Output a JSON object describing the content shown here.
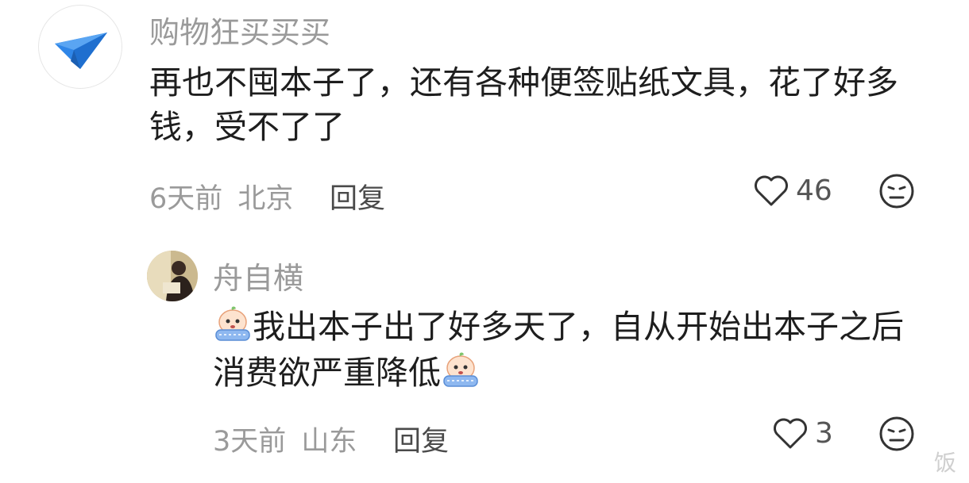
{
  "comments": [
    {
      "username": "购物狂买买买",
      "text": "再也不囤本子了，还有各种便签贴纸文具，花了好多钱，受不了了",
      "time": "6天前",
      "location": "北京",
      "reply_label": "回复",
      "likes": "46",
      "avatar_icon": "paper-plane-icon"
    },
    {
      "username": "舟自横",
      "text_part1": "我出本子出了好多天了，自从开始出本子之后消费欲严重降低",
      "time": "3天前",
      "location": "山东",
      "reply_label": "回复",
      "likes": "3",
      "sticker_icon": "crying-bun-sticker-icon"
    }
  ],
  "watermark": "饭",
  "colors": {
    "accent": "#3a8ee6",
    "meta": "#9a9a9a"
  }
}
